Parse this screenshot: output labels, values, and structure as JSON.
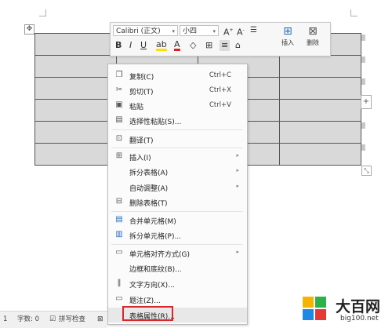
{
  "toolbar": {
    "font_name": "Calibri (正文)",
    "font_size": "小四",
    "insert_label": "插入",
    "delete_label": "删除"
  },
  "menu": {
    "items": [
      {
        "label": "复制(C)",
        "shortcut": "Ctrl+C",
        "icon": "copy-icon"
      },
      {
        "label": "剪切(T)",
        "shortcut": "Ctrl+X",
        "icon": "scissors-icon"
      },
      {
        "label": "粘贴",
        "shortcut": "Ctrl+V",
        "icon": "paste-icon"
      },
      {
        "label": "选择性粘贴(S)...",
        "shortcut": "",
        "icon": "paste-special-icon"
      },
      {
        "label": "翻译(T)",
        "shortcut": "",
        "icon": "translate-icon"
      },
      {
        "label": "插入(I)",
        "shortcut": "",
        "icon": "table-insert-icon"
      },
      {
        "label": "拆分表格(A)",
        "shortcut": "",
        "icon": ""
      },
      {
        "label": "自动调整(A)",
        "shortcut": "",
        "icon": ""
      },
      {
        "label": "删除表格(T)",
        "shortcut": "",
        "icon": "table-delete-icon"
      },
      {
        "label": "合并单元格(M)",
        "shortcut": "",
        "icon": "merge-cells-icon"
      },
      {
        "label": "拆分单元格(P)...",
        "shortcut": "",
        "icon": "split-cells-icon"
      },
      {
        "label": "单元格对齐方式(G)",
        "shortcut": "",
        "icon": "cell-align-icon"
      },
      {
        "label": "边框和底纹(B)...",
        "shortcut": "",
        "icon": ""
      },
      {
        "label": "文字方向(X)...",
        "shortcut": "",
        "icon": "text-direction-icon"
      },
      {
        "label": "题注(Z)...",
        "shortcut": "",
        "icon": "caption-icon"
      },
      {
        "label": "表格属性(R)...",
        "shortcut": "",
        "icon": ""
      }
    ]
  },
  "status": {
    "page": "1",
    "word_count": "字数: 0",
    "spell_check": "拼写检查"
  },
  "watermark": {
    "name": "大百网",
    "url": "big100.net"
  },
  "colors": {
    "highlight_border": "#d9262b",
    "cell_fill": "#d9d9d9"
  }
}
